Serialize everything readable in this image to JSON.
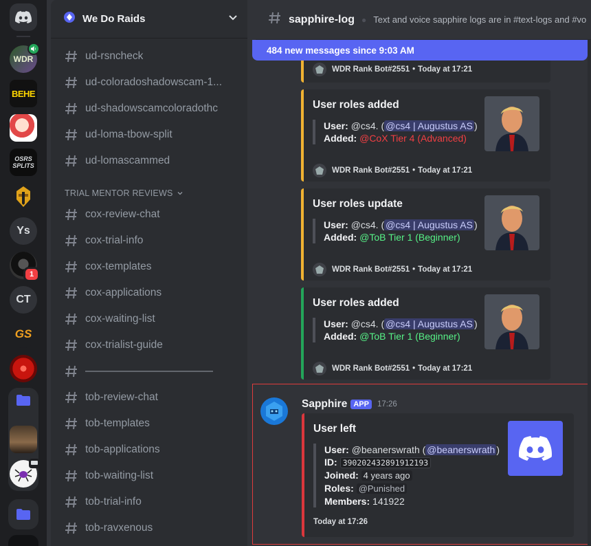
{
  "servers": [
    {
      "abbr": ""
    },
    {
      "abbr": ""
    },
    {
      "abbr": "BEHE"
    },
    {
      "abbr": ""
    },
    {
      "abbr": "OSRS SPLITS"
    },
    {
      "abbr": ""
    },
    {
      "abbr": "Ys"
    },
    {
      "abbr": "",
      "badge": "1"
    },
    {
      "abbr": "CT"
    },
    {
      "abbr": "GS"
    },
    {
      "abbr": ""
    }
  ],
  "server": {
    "name": "We Do Raids"
  },
  "channels_top": [
    "ud-rsncheck",
    "ud-coloradoshadowscam-1...",
    "ud-shadowscamcoloradothc",
    "ud-loma-tbow-split",
    "ud-lomascammed"
  ],
  "category": {
    "label": "TRIAL MENTOR REVIEWS"
  },
  "channels_cat": [
    "cox-review-chat",
    "cox-trial-info",
    "cox-templates",
    "cox-applications",
    "cox-waiting-list",
    "cox-trialist-guide",
    "————————————",
    "tob-review-chat",
    "tob-templates",
    "tob-applications",
    "tob-waiting-list",
    "tob-trial-info",
    "tob-ravxenous"
  ],
  "chat": {
    "channel": "sapphire-log",
    "topic": "Text and voice sapphire logs are in #text-logs and #vo",
    "new_messages": "484 new messages since 9:03 AM"
  },
  "bot_footer": {
    "author": "WDR Rank Bot#2551",
    "time": "Today at 17:21"
  },
  "embeds": [
    {
      "title": "User roles added",
      "user_label": "User:",
      "user": "@cs4.",
      "mention": "@cs4 | Augustus AS",
      "added_label": "Added:",
      "role": "@CoX Tier 4 (Advanced)"
    },
    {
      "title": "User roles update",
      "user_label": "User:",
      "user": "@cs4.",
      "mention": "@cs4 | Augustus AS",
      "added_label": "Added:",
      "role": "@ToB Tier 1 (Beginner)"
    },
    {
      "title": "User roles added",
      "user_label": "User:",
      "user": "@cs4.",
      "mention": "@cs4 | Augustus AS",
      "added_label": "Added:",
      "role": "@ToB Tier 1 (Beginner)"
    }
  ],
  "message": {
    "author": "Sapphire",
    "tag": "APP",
    "time": "17:26",
    "embed": {
      "title": "User left",
      "user_label": "User:",
      "user": "@beanerswrath",
      "mention": "@beanerswrath",
      "id_label": "ID:",
      "id": "390202432891912193",
      "joined_label": "Joined:",
      "joined": "4 years ago",
      "roles_label": "Roles:",
      "roles": "@Punished",
      "members_label": "Members:",
      "members": "141922",
      "footer": "Today at 17:26"
    }
  },
  "colors": {
    "accent": "#5865f2",
    "green": "#23a559",
    "gold": "#f0b232",
    "red": "#da373c"
  }
}
